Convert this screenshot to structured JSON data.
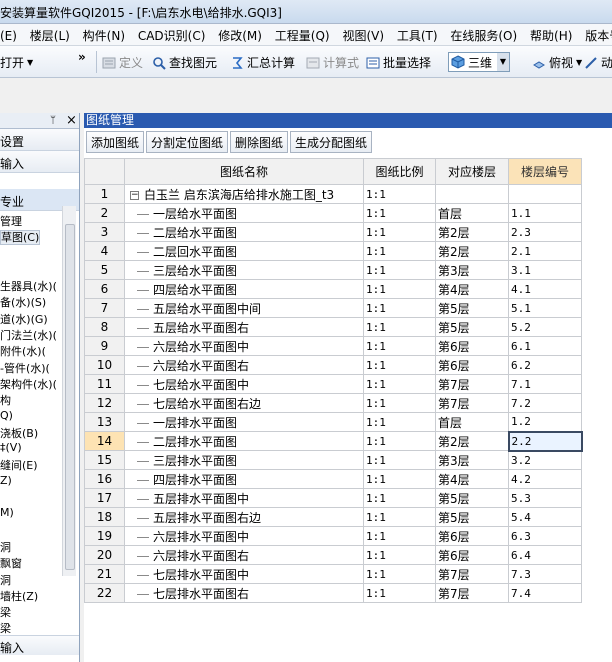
{
  "window": {
    "title": "安装算量软件GQI2015 - [F:\\启东水电\\给排水.GQI3]"
  },
  "menu": [
    "(E)",
    "楼层(L)",
    "构件(N)",
    "CAD识别(C)",
    "修改(M)",
    "工程量(Q)",
    "视图(V)",
    "工具(T)",
    "在线服务(O)",
    "帮助(H)",
    "版本号(B)"
  ],
  "toolbar": {
    "open_label": "打开",
    "more_glyph": "»",
    "define_label": "定义",
    "find_element_label": "查找图元",
    "summary_calc_label": "汇总计算",
    "formula_label": "计算式",
    "batch_select_label": "批量选择",
    "view_mode_value": "三维",
    "top_view_label": "俯视",
    "dynamic_label": "动态"
  },
  "left_panel": {
    "pin_glyph": "ᛘ",
    "close_glyph": "×",
    "rows": [
      "设置",
      "输入"
    ],
    "selected_row": "专业",
    "tree": [
      "管理",
      "草图(C)",
      "",
      "",
      "生器具(水)(",
      "备(水)(S)",
      "道(水)(G)",
      "门法兰(水)(",
      "附件(水)(",
      "-管件(水)(",
      "架构件(水)(",
      "构",
      "Q)",
      "浇板(B)",
      "‡(V)",
      "缝间(E)",
      "Z)",
      "",
      "M)",
      "",
      "洞",
      "飘窗",
      "洞",
      "墙柱(Z)",
      "梁",
      "梁"
    ],
    "bottom_label": "输入"
  },
  "drawing_manager": {
    "title": "图纸管理",
    "buttons": [
      "添加图纸",
      "分割定位图纸",
      "删除图纸",
      "生成分配图纸"
    ],
    "columns": [
      "图纸名称",
      "图纸比例",
      "对应楼层",
      "楼层编号"
    ],
    "collapse_glyph": "−",
    "rows": [
      {
        "no": "1",
        "name": "白玉兰 启东滨海店给排水施工图_t3",
        "scale": "1:1",
        "floor": "",
        "floor_no": ""
      },
      {
        "no": "2",
        "name": "一层给水平面图",
        "scale": "1:1",
        "floor": "首层",
        "floor_no": "1.1"
      },
      {
        "no": "3",
        "name": "二层给水平面图",
        "scale": "1:1",
        "floor": "第2层",
        "floor_no": "2.3"
      },
      {
        "no": "4",
        "name": "二层回水平面图",
        "scale": "1:1",
        "floor": "第2层",
        "floor_no": "2.1"
      },
      {
        "no": "5",
        "name": "三层给水平面图",
        "scale": "1:1",
        "floor": "第3层",
        "floor_no": "3.1"
      },
      {
        "no": "6",
        "name": "四层给水平面图",
        "scale": "1:1",
        "floor": "第4层",
        "floor_no": "4.1"
      },
      {
        "no": "7",
        "name": "五层给水平面图中间",
        "scale": "1:1",
        "floor": "第5层",
        "floor_no": "5.1"
      },
      {
        "no": "8",
        "name": "五层给水平面图右",
        "scale": "1:1",
        "floor": "第5层",
        "floor_no": "5.2"
      },
      {
        "no": "9",
        "name": "六层给水平面图中",
        "scale": "1:1",
        "floor": "第6层",
        "floor_no": "6.1"
      },
      {
        "no": "10",
        "name": "六层给水平面图右",
        "scale": "1:1",
        "floor": "第6层",
        "floor_no": "6.2"
      },
      {
        "no": "11",
        "name": "七层给水平面图中",
        "scale": "1:1",
        "floor": "第7层",
        "floor_no": "7.1"
      },
      {
        "no": "12",
        "name": "七层给水平面图右边",
        "scale": "1:1",
        "floor": "第7层",
        "floor_no": "7.2"
      },
      {
        "no": "13",
        "name": "一层排水平面图",
        "scale": "1:1",
        "floor": "首层",
        "floor_no": "1.2"
      },
      {
        "no": "14",
        "name": "二层排水平面图",
        "scale": "1:1",
        "floor": "第2层",
        "floor_no": "2.2"
      },
      {
        "no": "15",
        "name": "三层排水平面图",
        "scale": "1:1",
        "floor": "第3层",
        "floor_no": "3.2"
      },
      {
        "no": "16",
        "name": "四层排水平面图",
        "scale": "1:1",
        "floor": "第4层",
        "floor_no": "4.2"
      },
      {
        "no": "17",
        "name": "五层排水平面图中",
        "scale": "1:1",
        "floor": "第5层",
        "floor_no": "5.3"
      },
      {
        "no": "18",
        "name": "五层排水平面图右边",
        "scale": "1:1",
        "floor": "第5层",
        "floor_no": "5.4"
      },
      {
        "no": "19",
        "name": "六层排水平面图中",
        "scale": "1:1",
        "floor": "第6层",
        "floor_no": "6.3"
      },
      {
        "no": "20",
        "name": "六层排水平面图右",
        "scale": "1:1",
        "floor": "第6层",
        "floor_no": "6.4"
      },
      {
        "no": "21",
        "name": "七层排水平面图中",
        "scale": "1:1",
        "floor": "第7层",
        "floor_no": "7.3"
      },
      {
        "no": "22",
        "name": "七层排水平面图右",
        "scale": "1:1",
        "floor": "第7层",
        "floor_no": "7.4"
      }
    ],
    "selected_row_no": "14"
  },
  "colors": {
    "title_blue": "#2a5ab0",
    "header_orange": "#fbe3b8",
    "selected_row": "#fde3b3"
  }
}
